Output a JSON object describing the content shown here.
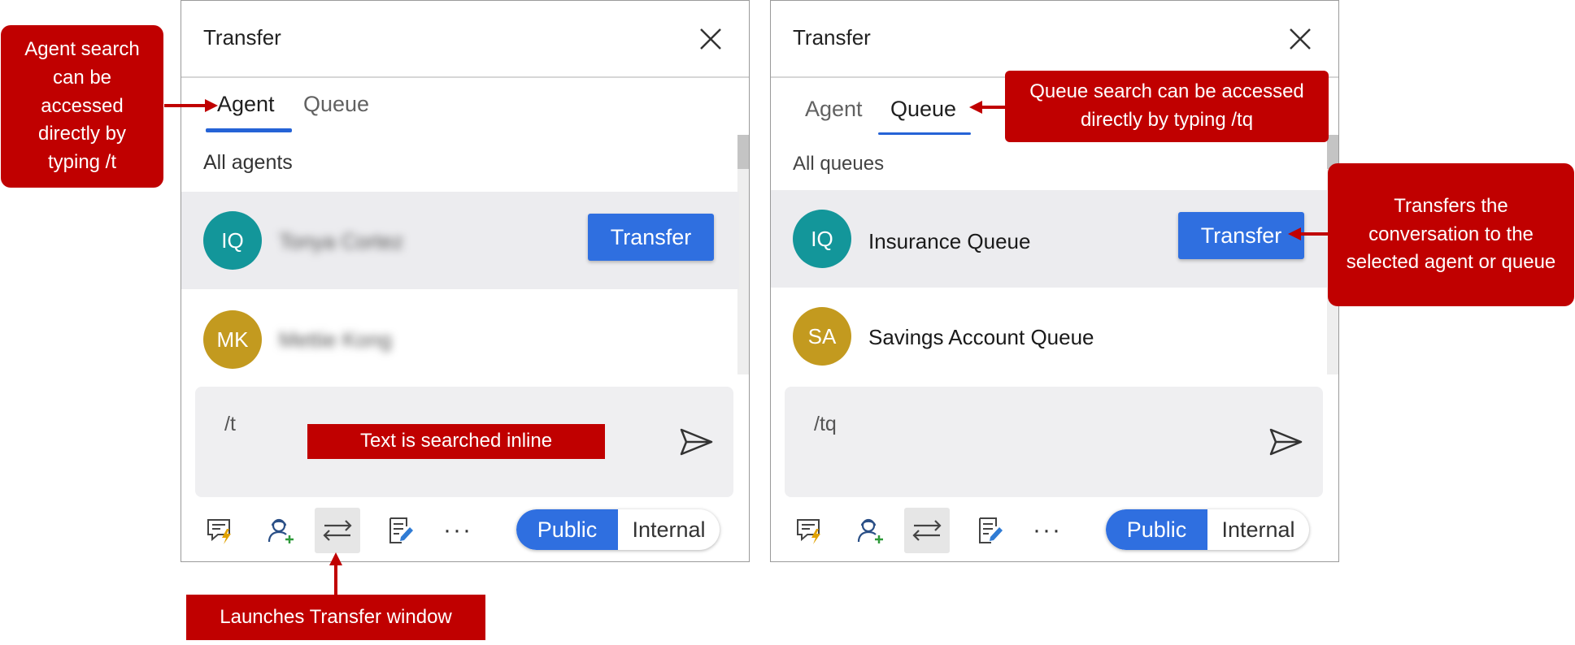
{
  "left_panel": {
    "title": "Transfer",
    "tabs": [
      {
        "label": "Agent",
        "active": true
      },
      {
        "label": "Queue",
        "active": false
      }
    ],
    "section_label": "All agents",
    "rows": [
      {
        "initials": "IQ",
        "name": "Tonya Cortez",
        "name_blurred": true,
        "avatar_color": "#13969a",
        "selected": true,
        "action_label": "Transfer"
      },
      {
        "initials": "MK",
        "name": "Mettie Kong",
        "name_blurred": true,
        "avatar_color": "#c39a1f",
        "selected": false
      }
    ],
    "compose_text": "/t",
    "toggle": {
      "public": "Public",
      "internal": "Internal",
      "selected": "Public"
    }
  },
  "right_panel": {
    "title": "Transfer",
    "tabs": [
      {
        "label": "Agent",
        "active": false
      },
      {
        "label": "Queue",
        "active": true
      }
    ],
    "section_label": "All queues",
    "rows": [
      {
        "initials": "IQ",
        "name": "Insurance Queue",
        "name_blurred": false,
        "avatar_color": "#13969a",
        "selected": true,
        "action_label": "Transfer"
      },
      {
        "initials": "SA",
        "name": "Savings Account Queue",
        "name_blurred": false,
        "avatar_color": "#c39a1f",
        "selected": false
      }
    ],
    "compose_text": "/tq",
    "toggle": {
      "public": "Public",
      "internal": "Internal",
      "selected": "Public"
    }
  },
  "toolbar_icons": [
    "quick-replies-icon",
    "consult-agent-icon",
    "transfer-icon",
    "notes-icon",
    "more-icon"
  ],
  "callouts": {
    "agent_search": "Agent search can be accessed directly by typing /t",
    "inline_search": "Text is searched inline",
    "launches_transfer": "Launches Transfer window",
    "queue_search": "Queue search can be accessed directly by typing /tq",
    "transfers_conversation": "Transfers the conversation to the selected agent or queue"
  },
  "colors": {
    "accent": "#2f6fe0",
    "callout": "#c00000",
    "avatar_teal": "#13969a",
    "avatar_gold": "#c39a1f"
  }
}
